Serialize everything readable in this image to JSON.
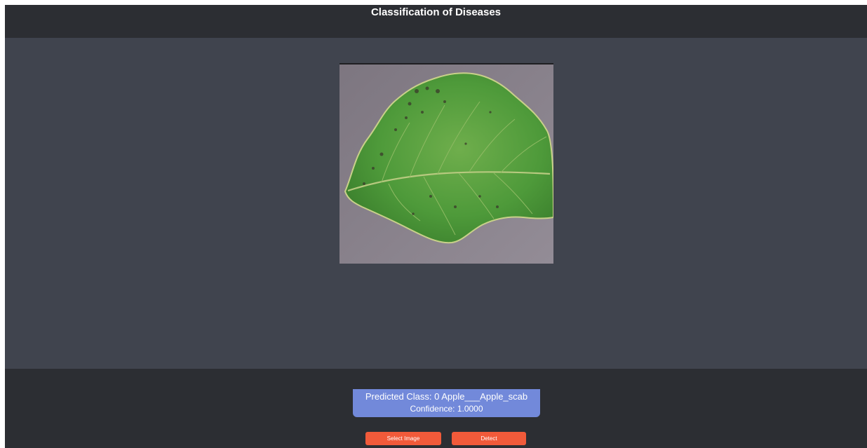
{
  "header": {
    "title": "Classification of Diseases"
  },
  "display": {
    "image_subject": "apple-leaf"
  },
  "result": {
    "predicted_class": "Predicted Class: 0 Apple___Apple_scab",
    "confidence": "Confidence: 1.0000"
  },
  "buttons": {
    "select_image": "Select Image",
    "detect": "Detect"
  },
  "colors": {
    "header_bg": "#2c2e33",
    "display_bg": "#40444e",
    "result_bg": "#7289da",
    "button_bg": "#f15a3a"
  }
}
